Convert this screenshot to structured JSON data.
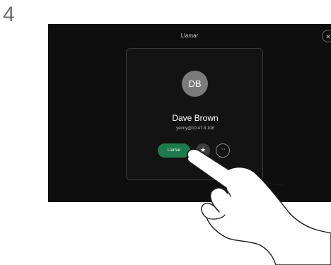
{
  "step": {
    "number": "4"
  },
  "screen": {
    "title": "Llamar",
    "close_icon": "close-icon"
  },
  "contact": {
    "initials": "DB",
    "name": "Dave Brown",
    "address": "yenny@10.47.8.108"
  },
  "actions": {
    "call_label": "Llamar",
    "favorite_icon": "star-icon",
    "more_icon": "more-icon"
  },
  "colors": {
    "screen_background": "#0e0e0e",
    "call_button": "#1d7a4d",
    "avatar": "#7a7a7a"
  }
}
